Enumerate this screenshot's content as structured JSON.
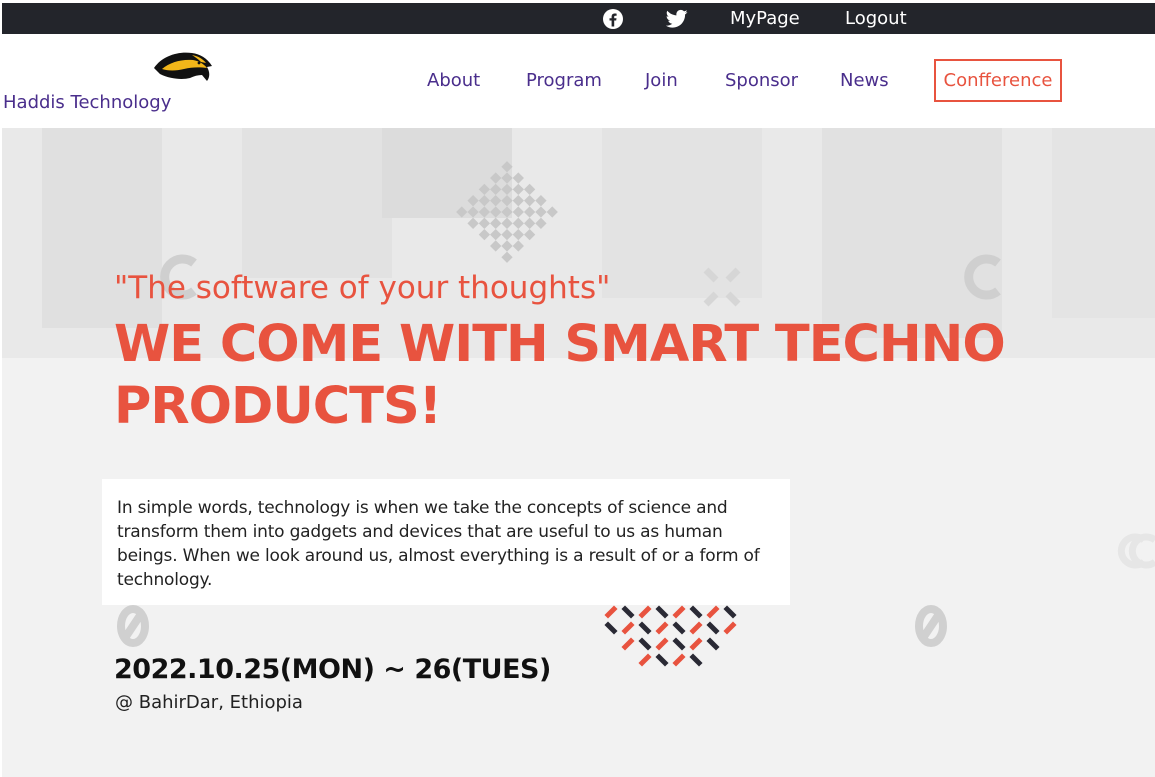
{
  "topbar": {
    "social": [
      {
        "icon": "facebook-icon"
      },
      {
        "icon": "twitter-icon"
      }
    ],
    "mypage": "MyPage",
    "logout": "Logout"
  },
  "header": {
    "brand": "Haddis Technology",
    "logo_icon": "eagle-logo-icon",
    "nav": {
      "about": "About",
      "program": "Program",
      "join": "Join",
      "sponsor": "Sponsor",
      "news": "News",
      "conference": "Confference"
    }
  },
  "hero": {
    "tagline": "\"The software of your thoughts\"",
    "headline": "WE COME WITH SMART TECHNO PRODUCTS!",
    "description": "In simple words, technology is when we take the concepts of science and transform them into gadgets and devices that are useful to us as human beings. When we look around us, almost everything is a result of or a form of technology.",
    "date": "2022.10.25(MON) ~ 26(TUES)",
    "location": "@ BahirDar, Ethiopia"
  },
  "colors": {
    "accent": "#e8533f",
    "nav_text": "#4a2e8c",
    "topbar": "#23252b"
  }
}
